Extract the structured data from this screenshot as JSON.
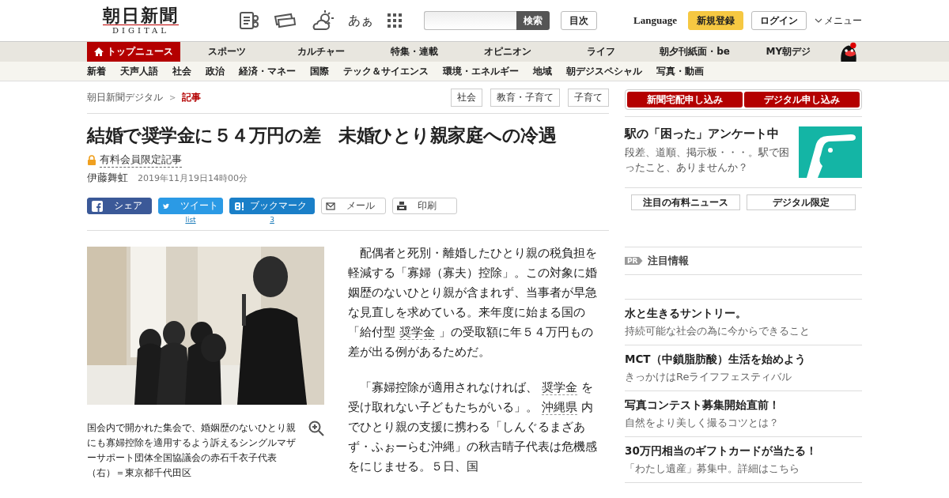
{
  "header": {
    "logo": "朝日新聞",
    "logo_sub": "DIGITAL",
    "font_toggle": "あぁ",
    "search_button": "検索",
    "index_button": "目次",
    "language": "Language",
    "register": "新規登録",
    "login": "ログイン",
    "menu": "メニュー"
  },
  "main_nav": [
    {
      "label": "トップニュース",
      "selected": true
    },
    {
      "label": "スポーツ",
      "selected": false
    },
    {
      "label": "カルチャー",
      "selected": false
    },
    {
      "label": "特集・連載",
      "selected": false
    },
    {
      "label": "オピニオン",
      "selected": false
    },
    {
      "label": "ライフ",
      "selected": false
    },
    {
      "label": "朝夕刊紙面・be",
      "selected": false
    },
    {
      "label": "MY朝デジ",
      "selected": false
    }
  ],
  "sub_nav": [
    "新着",
    "天声人語",
    "社会",
    "政治",
    "経済・マネー",
    "国際",
    "テック＆サイエンス",
    "環境・エネルギー",
    "地域",
    "朝デジスペシャル",
    "写真・動画"
  ],
  "breadcrumb": [
    "朝日新聞デジタル",
    "記事"
  ],
  "breadcrumb_separator": ">",
  "tags": [
    "社会",
    "教育・子育て",
    "子育て"
  ],
  "article": {
    "title": "結婚で奨学金に５４万円の差　未婚ひとり親家庭への冷遇",
    "paywall": "有料会員限定記事",
    "author": "伊藤舞虹",
    "date": "2019年11月19日14時00分",
    "share": [
      {
        "kind": "facebook",
        "label": "シェア"
      },
      {
        "kind": "twitter",
        "label": "ツイート",
        "count": "list"
      },
      {
        "kind": "hatena",
        "label": "ブックマーク",
        "count": "3"
      },
      {
        "kind": "mail",
        "label": "メール"
      },
      {
        "kind": "print",
        "label": "印刷"
      }
    ],
    "photo": {
      "caption": "国会内で開かれた集会で、婚姻歴のないひとり親にも寡婦控除を適用するよう訴えるシングルマザーサポート団体全国協議会の赤石千衣子代表（右）＝東京都千代田区"
    },
    "paragraphs": [
      [
        {
          "text": "　配偶者と死別・離婚したひとり親の税負担を軽減する「寡婦（寡夫）控除」。この対象に婚姻歴のないひとり親が含まれず、当事者が早急な見直しを求めている。来年度に始まる国の「給付型 ",
          "kind": "text"
        },
        {
          "text": "奨学金",
          "kind": "link"
        },
        {
          "text": " 」の受取額に年５４万円もの差が出る例があるためだ。",
          "kind": "text"
        }
      ],
      [
        {
          "text": "　「寡婦控除が適用されなければ、 ",
          "kind": "text"
        },
        {
          "text": "奨学金",
          "kind": "link"
        },
        {
          "text": " を受け取れない子どもたちがいる」。 ",
          "kind": "text"
        },
        {
          "text": "沖縄県",
          "kind": "link"
        },
        {
          "text": " 内でひとり親の支援に携わる「しんぐるまざあず・ふぉーらむ沖縄」の秋吉晴子代表は危機感をにじませる。５日、国",
          "kind": "text"
        }
      ]
    ]
  },
  "sidebar": {
    "apply_buttons": [
      "新聞宅配申し込み",
      "デジタル申し込み"
    ],
    "promo": {
      "title": "駅の「困った」アンケート中",
      "text": "段差、道順、掲示板・・・。駅で困ったこと、ありませんか？"
    },
    "tabs": [
      "注目の有料ニュース",
      "デジタル限定"
    ],
    "pr_badge": "PR",
    "pr_title": "注目情報",
    "pr_items": [
      {
        "title": "水と生きるサントリー。",
        "text": "持続可能な社会の為に今からできること"
      },
      {
        "title": "MCT（中鎖脂肪酸）生活を始めよう",
        "text": "きっかけはReライフフェスティバル"
      },
      {
        "title": "写真コンテスト募集開始直前！",
        "text": "自然をより美しく撮るコツとは？"
      },
      {
        "title": "30万円相当のギフトカードが当たる！",
        "text": "「わたし遺産」募集中。詳細はこちら"
      }
    ]
  }
}
